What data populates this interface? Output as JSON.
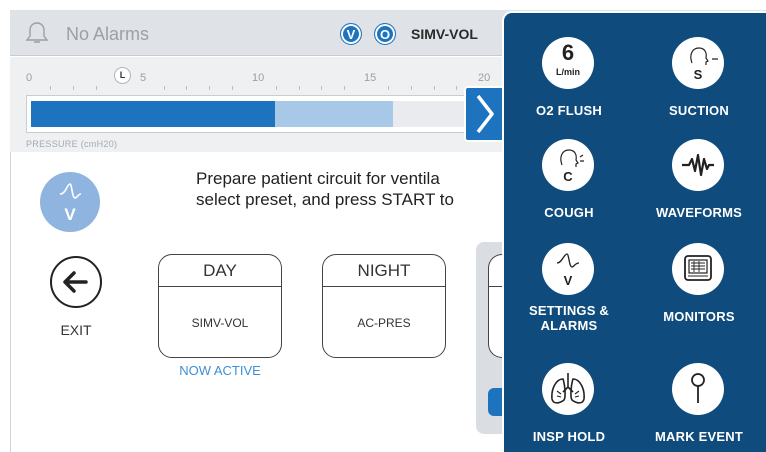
{
  "header": {
    "alarm_status": "No Alarms",
    "mode_badges": [
      "V",
      "O"
    ],
    "mode": "SIMV-VOL"
  },
  "gauge": {
    "ticks": [
      "0",
      "5",
      "10",
      "15",
      "20"
    ],
    "limit_marker": "L",
    "label": "PRESSURE (cmH20)",
    "fill_dark": 0.24,
    "fill_light": 0.35
  },
  "main": {
    "instruction_line1": "Prepare patient circuit for ventila",
    "instruction_line2": "select preset, and press START to",
    "settings_letter": "V",
    "exit_label": "EXIT",
    "presets": [
      {
        "title": "DAY",
        "mode": "SIMV-VOL"
      },
      {
        "title": "NIGHT",
        "mode": "AC-PRES"
      }
    ],
    "now_active": "NOW ACTIVE"
  },
  "quick_panel": {
    "o2_flush": {
      "value": "6",
      "unit": "L/min",
      "label": "O2 FLUSH"
    },
    "suction": {
      "letter": "S",
      "label": "SUCTION"
    },
    "cough": {
      "letter": "C",
      "label": "COUGH"
    },
    "waveforms": {
      "label": "WAVEFORMS"
    },
    "settings_alarms": {
      "letter": "V",
      "label_line1": "SETTINGS &",
      "label_line2": "ALARMS"
    },
    "monitors": {
      "label": "MONITORS"
    },
    "insp_hold": {
      "label": "INSP HOLD"
    },
    "mark_event": {
      "label": "MARK EVENT"
    }
  },
  "colors": {
    "accent": "#1e73be",
    "panel": "#0f4b7c",
    "bar_light": "#a8c8e8",
    "settings_circle": "#8fb4e0",
    "now_active": "#3f8fd4"
  }
}
